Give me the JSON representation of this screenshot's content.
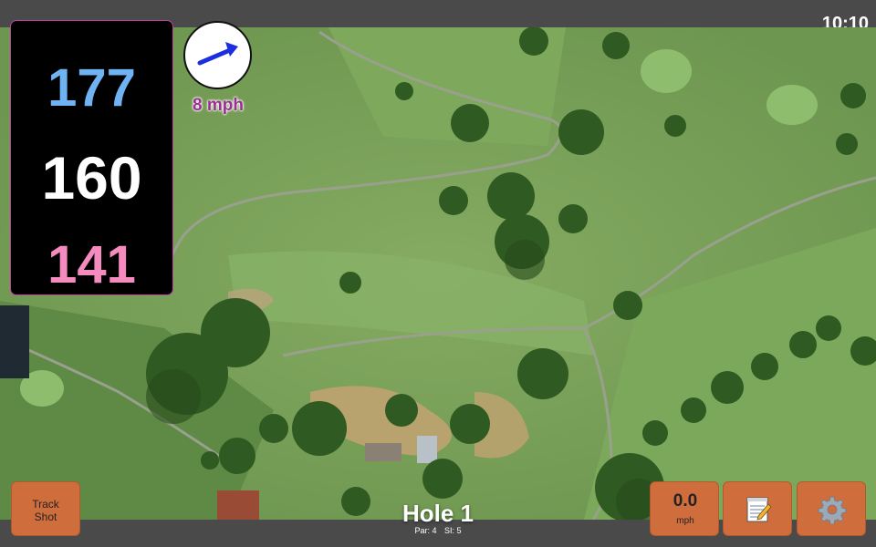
{
  "status": {
    "clock": "10:10"
  },
  "yardages": {
    "back": "177",
    "center": "160",
    "front": "141"
  },
  "wind": {
    "speed_label": "8 mph",
    "icon": "wind-arrow-icon"
  },
  "hole": {
    "title": "Hole 1",
    "par": "Par: 4",
    "si": "SI: 5"
  },
  "buttons": {
    "track_shot": "Track\nShot",
    "speed_value": "0.0",
    "speed_unit": "mph",
    "notes_icon": "notepad-icon",
    "settings_icon": "gear-icon"
  },
  "colors": {
    "back_yardage": "#6fb3f2",
    "center_yardage": "#ffffff",
    "front_yardage": "#f48bbf",
    "button": "#cf6e3c",
    "wind_text": "#9b2f93"
  }
}
